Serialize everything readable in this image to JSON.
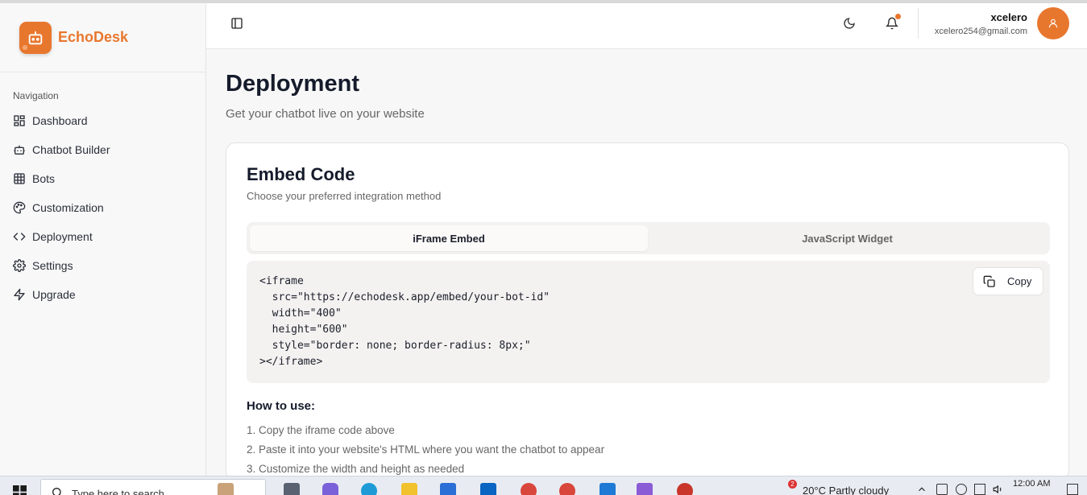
{
  "brand": {
    "name": "EchoDesk"
  },
  "sidebar": {
    "section_title": "Navigation",
    "items": [
      {
        "label": "Dashboard",
        "icon": "dashboard-icon"
      },
      {
        "label": "Chatbot Builder",
        "icon": "bot-icon"
      },
      {
        "label": "Bots",
        "icon": "grid-icon"
      },
      {
        "label": "Customization",
        "icon": "palette-icon"
      },
      {
        "label": "Deployment",
        "icon": "code-icon"
      },
      {
        "label": "Settings",
        "icon": "gear-icon"
      },
      {
        "label": "Upgrade",
        "icon": "zap-icon"
      }
    ]
  },
  "header": {
    "user_name": "xcelero",
    "user_email": "xcelero254@gmail.com"
  },
  "page": {
    "title": "Deployment",
    "subtitle": "Get your chatbot live on your website"
  },
  "card": {
    "title": "Embed Code",
    "subtitle": "Choose your preferred integration method",
    "tabs": [
      {
        "label": "iFrame Embed",
        "active": true
      },
      {
        "label": "JavaScript Widget",
        "active": false
      }
    ],
    "code": "<iframe\n  src=\"https://echodesk.app/embed/your-bot-id\"\n  width=\"400\"\n  height=\"600\"\n  style=\"border: none; border-radius: 8px;\"\n></iframe>",
    "copy_label": "Copy",
    "howto_title": "How to use:",
    "steps": [
      "1. Copy the iframe code above",
      "2. Paste it into your website's HTML where you want the chatbot to appear",
      "3. Customize the width and height as needed"
    ]
  },
  "taskbar": {
    "search_placeholder": "Type here to search",
    "weather": "20°C  Partly cloudy",
    "notification_count": "2",
    "time": "12:00 AM"
  },
  "colors": {
    "accent": "#e8772e",
    "text_dark": "#151b2b",
    "muted": "#666666"
  }
}
